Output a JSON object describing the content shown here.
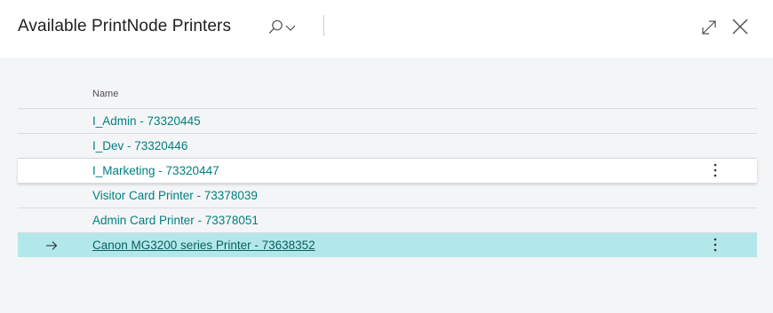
{
  "header": {
    "title": "Available PrintNode Printers"
  },
  "list": {
    "column_header": "Name",
    "rows": [
      {
        "name": "I_Admin - 73320445"
      },
      {
        "name": "I_Dev - 73320446"
      },
      {
        "name": "I_Marketing - 73320447"
      },
      {
        "name": "Visitor Card Printer - 73378039"
      },
      {
        "name": "Admin Card Printer - 73378051"
      },
      {
        "name": "Canon MG3200 series Printer - 73638352"
      }
    ]
  },
  "icons": {
    "search": "search-icon",
    "chevron": "chevron-down-icon",
    "expand": "expand-icon",
    "close": "close-icon",
    "row_arrow": "arrow-right-icon",
    "row_menu": "more-vertical-icon"
  },
  "colors": {
    "accent": "#00807e",
    "selected_row": "#b3e8ea",
    "page_bg": "#f4f5f7"
  }
}
